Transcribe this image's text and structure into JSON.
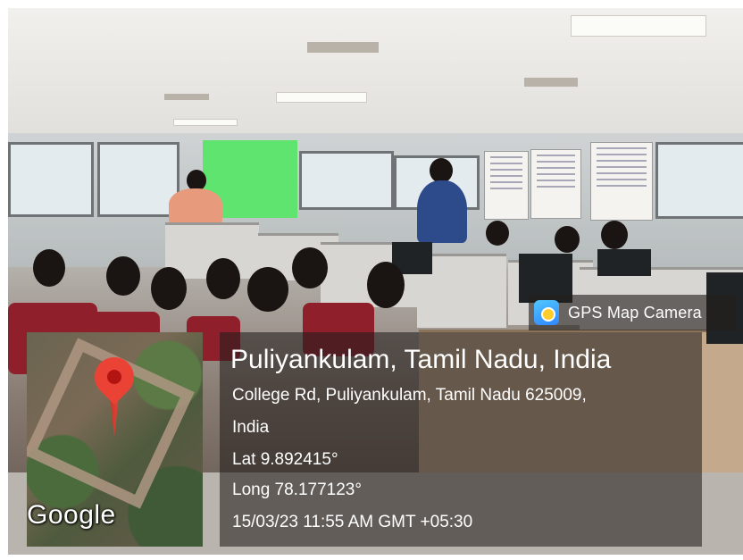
{
  "app": {
    "name": "GPS Map Camera",
    "logo_icon": "gps-map-camera-logo-icon"
  },
  "map": {
    "attribution": "Google",
    "pin_icon": "location-pin-icon"
  },
  "location": {
    "title": "Puliyankulam, Tamil Nadu, India",
    "address_line1": "College Rd, Puliyankulam, Tamil Nadu 625009,",
    "address_line2": "India",
    "latitude": "Lat 9.892415°",
    "longitude": "Long 78.177123°",
    "timestamp": "15/03/23 11:55 AM GMT +05:30"
  },
  "colors": {
    "overlay": "#231e1c",
    "pin": "#ea4335",
    "projector_screen": "#5fe470",
    "chairs": "#8f1f2b"
  }
}
